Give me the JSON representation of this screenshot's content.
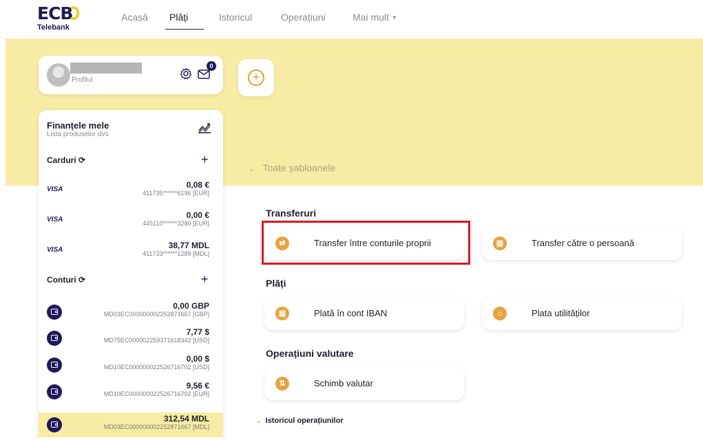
{
  "brand": {
    "logo": "ECB",
    "sub": "Telebank",
    "accent": "#e9d22e",
    "primary": "#1f1a5c"
  },
  "nav": {
    "items": [
      "Acasă",
      "Plăți",
      "Istoricul",
      "Operațiuni",
      "Mai mult"
    ],
    "active": "Plăți"
  },
  "profile": {
    "label": "Profilul",
    "unread": "0"
  },
  "templates_label": "Toate șabloanele",
  "finances": {
    "title": "Finanțele mele",
    "subtitle": "Lista produselor dvs",
    "cards_heading": "Carduri",
    "cards": [
      {
        "brand": "VISA",
        "amount": "0,08 €",
        "number": "411735******6196 [EUR]"
      },
      {
        "brand": "VISA",
        "amount": "0,00 €",
        "number": "445110******3280 [EUR]"
      },
      {
        "brand": "VISA",
        "amount": "38,77 MDL",
        "number": "411733******1289 [MDL]"
      }
    ],
    "accounts_heading": "Conturi",
    "accounts": [
      {
        "amount": "0,00 GBP",
        "number": "MD03EC000000002252871667 [GBP]"
      },
      {
        "amount": "7,77 $",
        "number": "MD75EC000002259371618342 [USD]"
      },
      {
        "amount": "0,00 $",
        "number": "MD10EC000000022526716702 [USD]"
      },
      {
        "amount": "9,56 €",
        "number": "MD10EC000000022526716702 [EUR]"
      },
      {
        "amount": "312,54 MDL",
        "number": "MD03EC000000002252871667 [MDL]"
      }
    ]
  },
  "sections": {
    "transfers": {
      "title": "Transferuri",
      "own": "Transfer între conturile proprii",
      "person": "Transfer către o persoană"
    },
    "payments": {
      "title": "Plăți",
      "iban": "Plată în cont IBAN",
      "utilities": "Plata utilităților"
    },
    "fx": {
      "title": "Operațiuni valutare",
      "exchange": "Schimb valutar"
    },
    "history": "Istoricul operațiunilor"
  }
}
